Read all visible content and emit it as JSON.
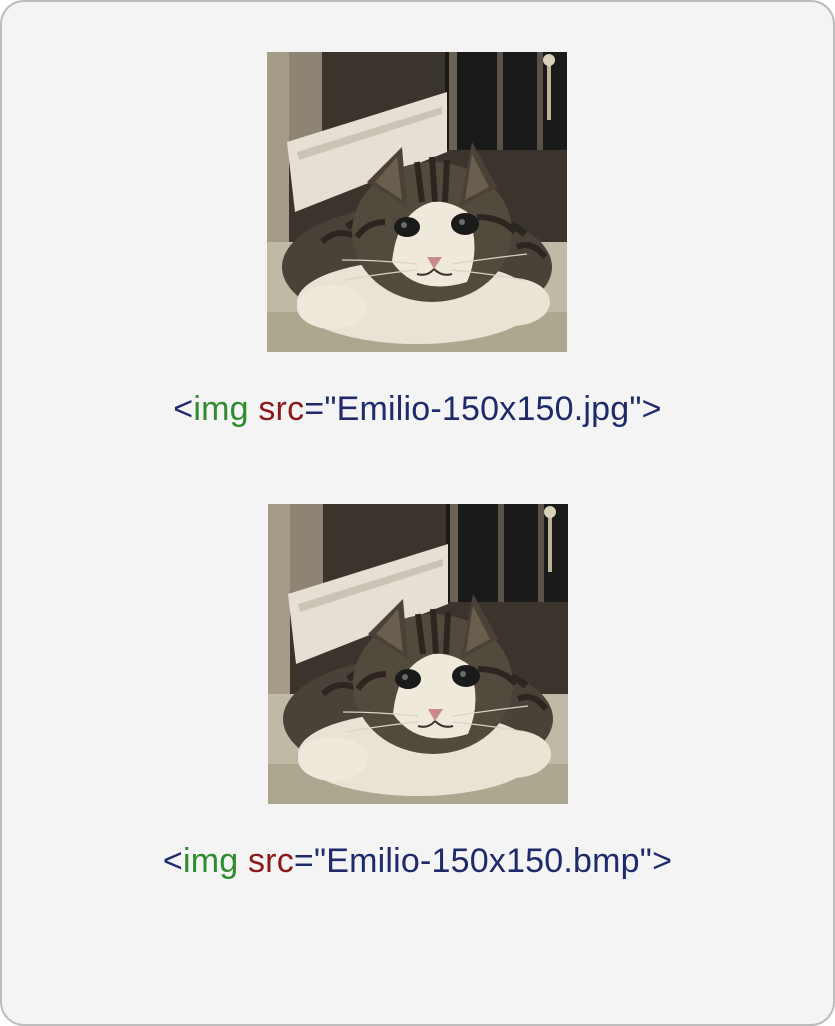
{
  "examples": [
    {
      "image_alt": "cat",
      "tag": "img",
      "attr": "src",
      "value": "\"Emilio-150x150.jpg\""
    },
    {
      "image_alt": "cat",
      "tag": "img",
      "attr": "src",
      "value": "\"Emilio-150x150.bmp\""
    }
  ]
}
